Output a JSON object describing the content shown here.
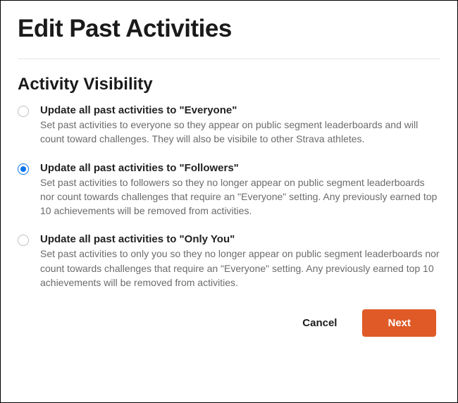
{
  "page_title": "Edit Past Activities",
  "section_title": "Activity Visibility",
  "options": [
    {
      "label": "Update all past activities to \"Everyone\"",
      "description": "Set past activities to everyone so they appear on public segment leaderboards and will count toward challenges. They will also be visibile to other Strava athletes.",
      "selected": false
    },
    {
      "label": "Update all past activities to \"Followers\"",
      "description": "Set past activities to followers so they no longer appear on public segment leaderboards nor count towards challenges that require an \"Everyone\" setting. Any previously earned top 10 achievements will be removed from activities.",
      "selected": true
    },
    {
      "label": "Update all past activities to \"Only You\"",
      "description": "Set past activities to only you so they no longer appear on public segment leaderboards nor count towards challenges that require an \"Everyone\" setting. Any previously earned top 10 achievements will be removed from activities.",
      "selected": false
    }
  ],
  "buttons": {
    "cancel": "Cancel",
    "next": "Next"
  },
  "colors": {
    "primary_button_bg": "#e05a27",
    "radio_selected": "#0b74ed"
  }
}
